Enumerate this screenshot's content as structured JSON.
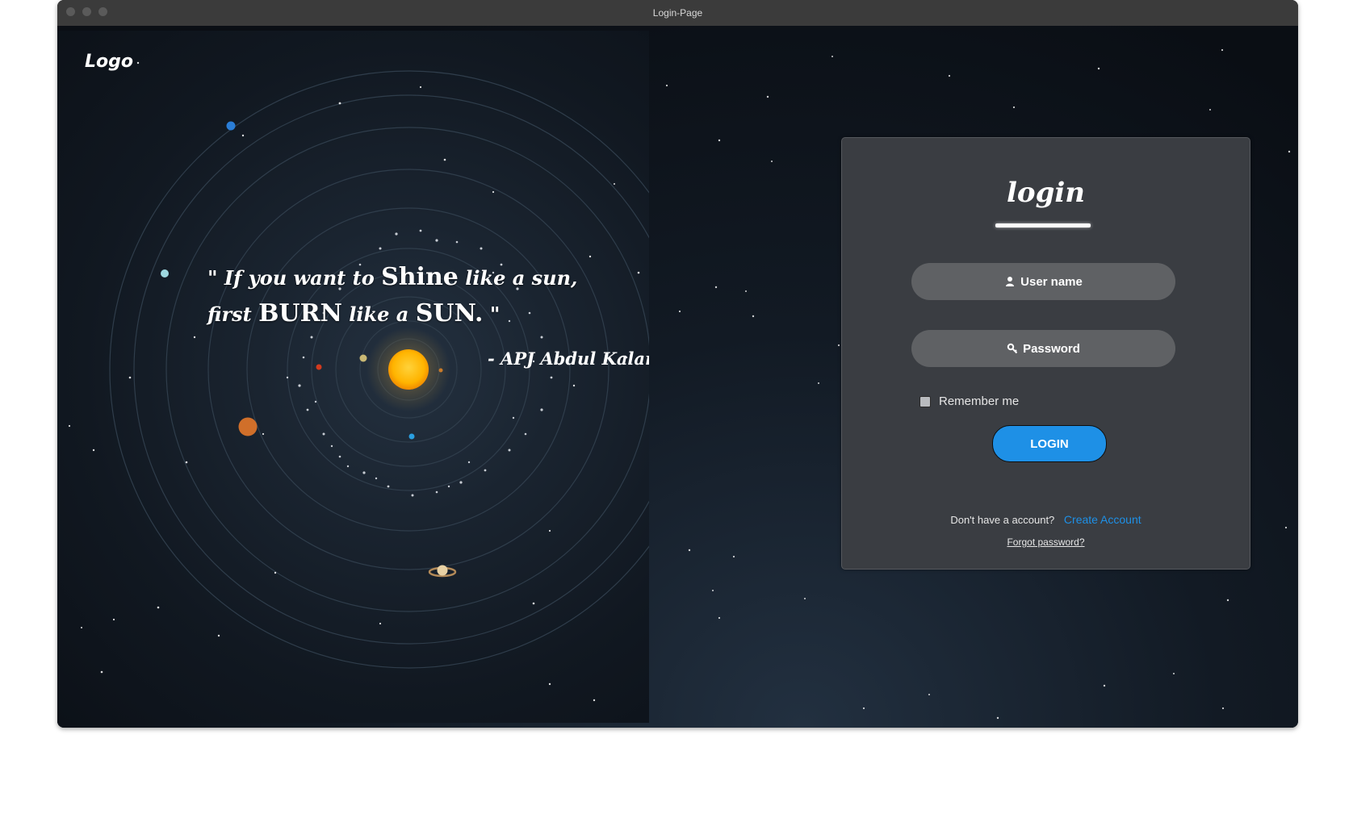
{
  "window": {
    "title": "Login-Page"
  },
  "brand": {
    "logo_text": "Logo"
  },
  "quote": {
    "line1_a": "\" If you want to",
    "line1_b": "Shine",
    "line1_c": "like a sun,",
    "line2_a": "first",
    "line2_b": "BURN",
    "line2_c": "like a",
    "line2_d": "SUN.",
    "line2_e": "\"",
    "author": "- APJ Abdul Kalam"
  },
  "login_form": {
    "title": "login",
    "username_label": "User name",
    "password_label": "Password",
    "remember_label": "Remember me",
    "remember_checked": false,
    "login_button": "LOGIN",
    "no_account_text": "Don't have a account?",
    "create_account_link": "Create Account",
    "forgot_password_link": "Forgot password?"
  },
  "colors": {
    "accent": "#1e90e6",
    "card_bg": "#3a3d42",
    "field_bg": "#5f6164",
    "titlebar": "#3b3b3b"
  },
  "icons": {
    "username": "user-icon",
    "password": "key-icon"
  }
}
